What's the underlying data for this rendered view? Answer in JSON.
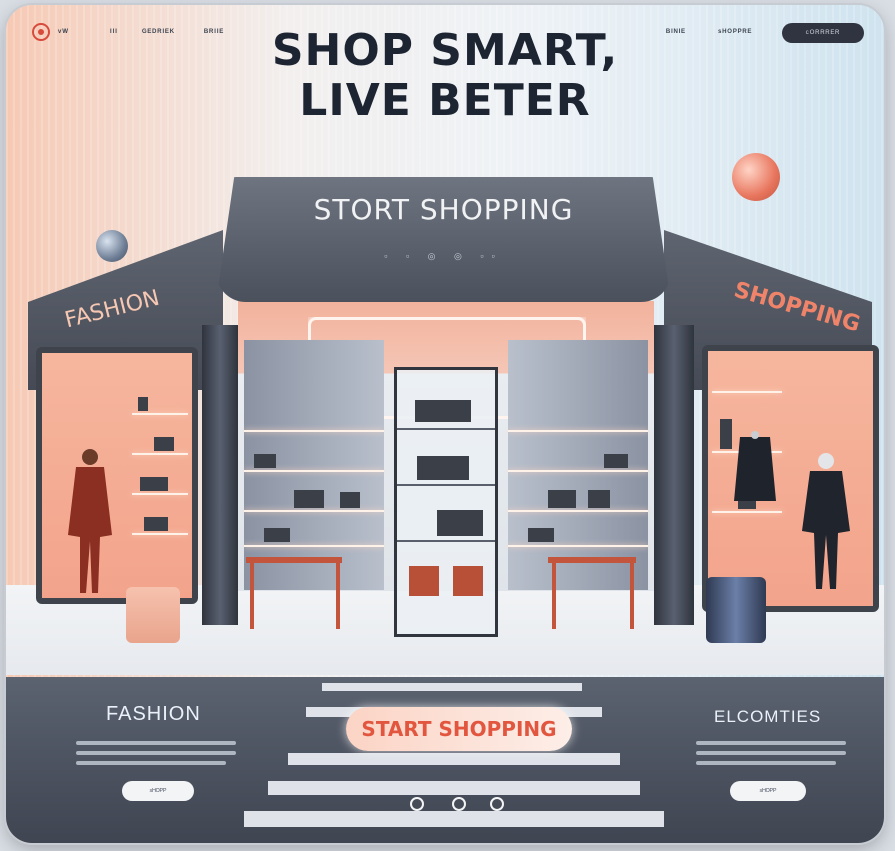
{
  "header": {
    "nav_left": [
      "ᵛᵂ",
      "ᴵᴵᴵ",
      "ᴳᴱᴰᴿᴵᴱᴷ",
      "ᴮᴿᴵᴵᴱ"
    ],
    "nav_right": [
      "ᴮᴵᴺᴵᴱ",
      "ˢᴴᴼᴾᴾᴿᴱ"
    ],
    "account_button": "ᶜᴼᴿᴿᴿᴱᴿ"
  },
  "hero": {
    "title_line1": "SHOP SMART,",
    "title_line2": "LIVE BETER"
  },
  "store": {
    "canopy_label": "STORT SHOPPING",
    "canopy_icons": "▫ ▫ ◎ ◎ ▫▫",
    "left_sign": "FASHION",
    "right_sign": "SHOPPING"
  },
  "bottom": {
    "left_title": "FASHION",
    "right_title": "ELCOMTIES",
    "cta_label": "START SHOPPING",
    "left_button": "ˢᴴᴼᴾᴾ",
    "right_button": "ˢᴴᴼᴾᴾ"
  },
  "colors": {
    "accent": "#e2563f",
    "dark": "#1d2533",
    "panel": "#4a505c"
  }
}
